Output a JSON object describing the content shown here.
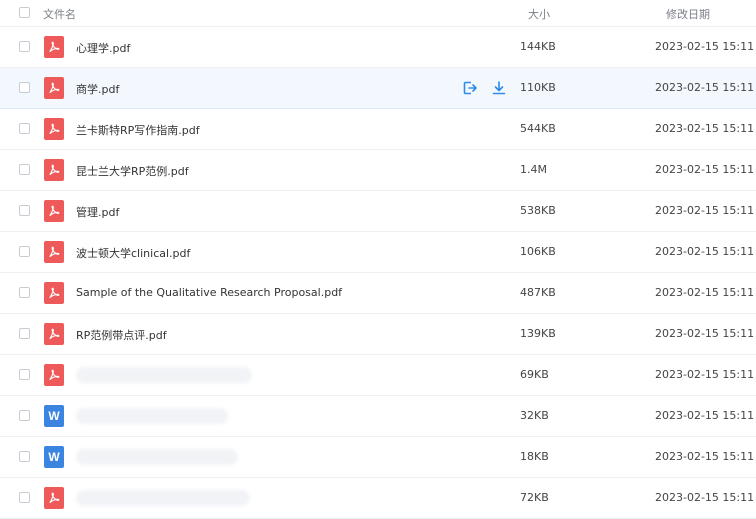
{
  "header": {
    "name_label": "文件名",
    "size_label": "大小",
    "date_label": "修改日期"
  },
  "actions": {
    "share_icon": "share-icon",
    "download_icon": "download-icon"
  },
  "colors": {
    "pdf": "#ee5a5a",
    "doc": "#3b84e0",
    "accent": "#2f8be6"
  },
  "files": [
    {
      "name": "心理学.pdf",
      "type": "pdf",
      "size": "144KB",
      "date": "2023-02-15 15:11"
    },
    {
      "name": "商学.pdf",
      "type": "pdf",
      "size": "110KB",
      "date": "2023-02-15 15:11"
    },
    {
      "name": "兰卡斯特RP写作指南.pdf",
      "type": "pdf",
      "size": "544KB",
      "date": "2023-02-15 15:11"
    },
    {
      "name": "昆士兰大学RP范例.pdf",
      "type": "pdf",
      "size": "1.4M",
      "date": "2023-02-15 15:11"
    },
    {
      "name": "管理.pdf",
      "type": "pdf",
      "size": "538KB",
      "date": "2023-02-15 15:11"
    },
    {
      "name": "波士顿大学clinical.pdf",
      "type": "pdf",
      "size": "106KB",
      "date": "2023-02-15 15:11"
    },
    {
      "name": "Sample of the Qualitative Research Proposal.pdf",
      "type": "pdf",
      "size": "487KB",
      "date": "2023-02-15 15:11"
    },
    {
      "name": "RP范例带点评.pdf",
      "type": "pdf",
      "size": "139KB",
      "date": "2023-02-15 15:11"
    },
    {
      "name": "",
      "type": "pdf",
      "size": "69KB",
      "date": "2023-02-15 15:11"
    },
    {
      "name": "",
      "type": "doc",
      "size": "32KB",
      "date": "2023-02-15 15:11"
    },
    {
      "name": "",
      "type": "doc",
      "size": "18KB",
      "date": "2023-02-15 15:11"
    },
    {
      "name": "",
      "type": "pdf",
      "size": "72KB",
      "date": "2023-02-15 15:11"
    }
  ]
}
